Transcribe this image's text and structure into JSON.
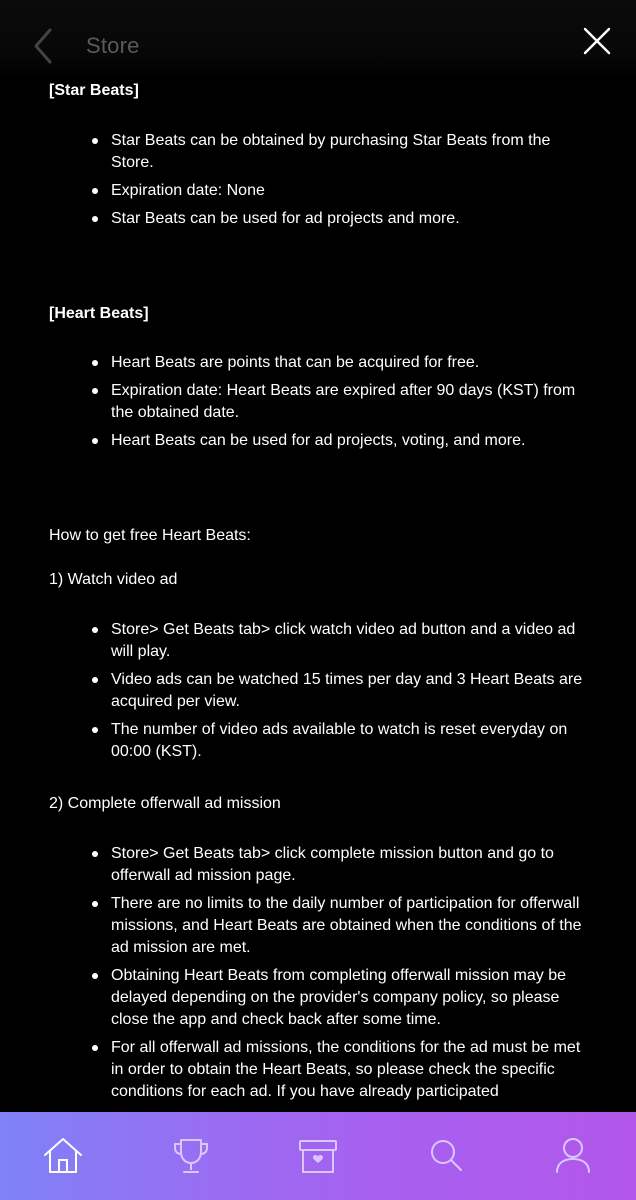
{
  "header": {
    "title": "Store",
    "back_icon": "chevron-left-icon",
    "close_icon": "close-icon"
  },
  "star_beats": {
    "title": "[Star Beats]",
    "bullets": [
      "Star Beats can be obtained by purchasing Star Beats from the Store.",
      "Expiration date: None",
      "Star Beats can be used for ad projects and more."
    ]
  },
  "heart_beats": {
    "title": "[Heart Beats]",
    "bullets": [
      "Heart Beats are points that can be acquired for free.",
      "Expiration date: Heart Beats are expired after 90 days (KST) from the obtained date.",
      "Heart Beats can be used for ad projects, voting, and more."
    ]
  },
  "free_heart_beats": {
    "intro": "How to get free Heart Beats:",
    "step1_title": "1) Watch video ad",
    "step1_bullets": [
      "Store> Get Beats tab> click watch video ad button and a video ad will play.",
      "Video ads can be watched 15 times per day and 3 Heart Beats are acquired per view.",
      "The number of video ads available to watch is reset everyday on 00:00 (KST)."
    ],
    "step2_title": "2) Complete offerwall ad mission",
    "step2_bullets": [
      "Store> Get Beats tab> click complete mission button and go to offerwall ad mission page.",
      "There are no limits to the daily number of participation for offerwall missions, and Heart Beats are obtained when the conditions of the ad mission are met.",
      "Obtaining Heart Beats from completing offerwall mission may be delayed depending on the provider's company policy, so please close the app and check back after some time.",
      "For all offerwall ad missions, the conditions for the ad must be met in order to obtain the Heart Beats, so please check the specific conditions for each ad. If you have already participated"
    ]
  },
  "bottom_nav": {
    "items": [
      {
        "icon": "home-icon"
      },
      {
        "icon": "trophy-icon"
      },
      {
        "icon": "gift-box-icon"
      },
      {
        "icon": "search-icon"
      },
      {
        "icon": "profile-icon"
      }
    ]
  },
  "colors": {
    "background": "#000000",
    "text": "#ffffff",
    "header_title": "#5a5a5a",
    "nav_gradient_start": "#7f82f6",
    "nav_gradient_end": "#b257ea"
  }
}
